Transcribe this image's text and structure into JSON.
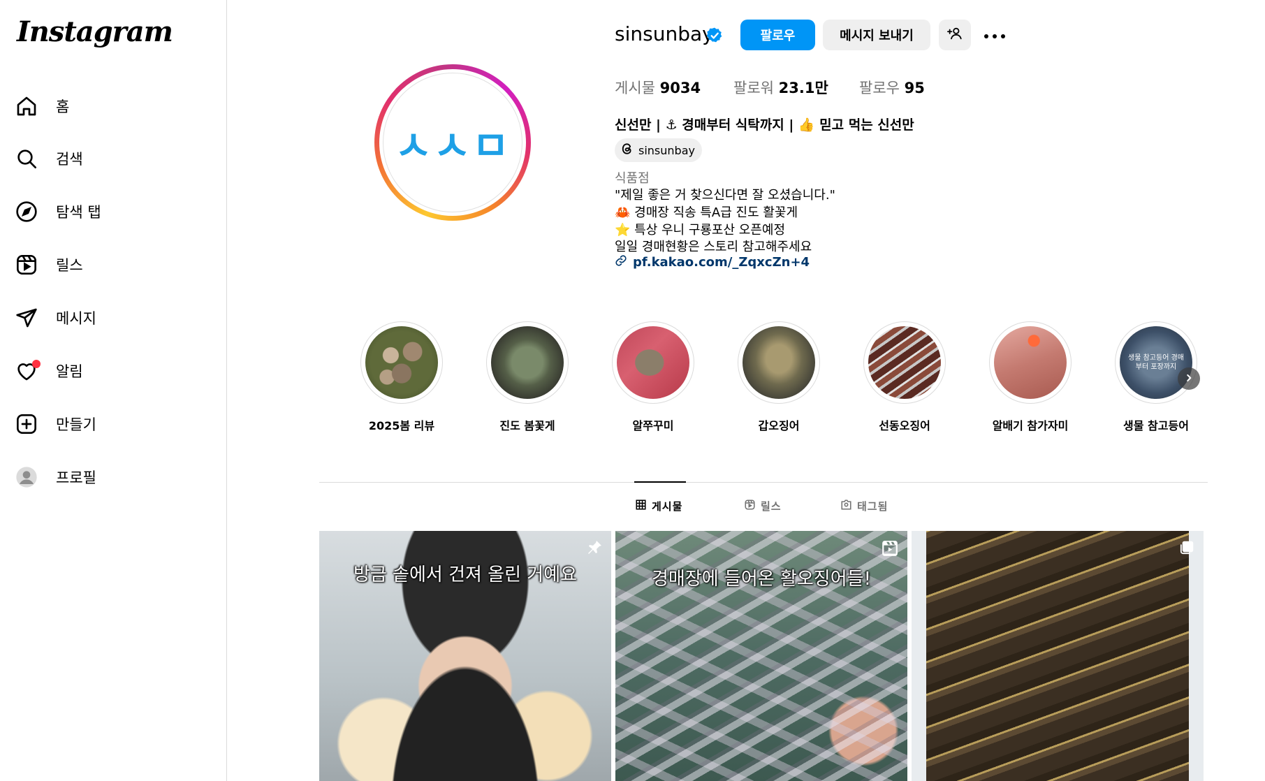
{
  "sidebar": {
    "logo": "Instagram",
    "items": [
      {
        "label": "홈",
        "icon": "home-icon"
      },
      {
        "label": "검색",
        "icon": "search-icon"
      },
      {
        "label": "탐색 탭",
        "icon": "compass-icon"
      },
      {
        "label": "릴스",
        "icon": "reels-icon"
      },
      {
        "label": "메시지",
        "icon": "send-icon"
      },
      {
        "label": "알림",
        "icon": "heart-icon"
      },
      {
        "label": "만들기",
        "icon": "create-icon"
      },
      {
        "label": "프로필",
        "icon": "profile-avatar-icon"
      }
    ]
  },
  "profile": {
    "username": "sinsunbay",
    "verified": true,
    "avatar_text": "ㅅㅅㅁ",
    "follow_label": "팔로우",
    "message_label": "메시지 보내기",
    "stats": {
      "posts_label": "게시물",
      "posts_value": "9034",
      "followers_label": "팔로워",
      "followers_value": "23.1만",
      "following_label": "팔로우",
      "following_value": "95"
    },
    "bio_name": "신선만 | ⚓ 경매부터 식탁까지 | 👍 믿고 먹는 신선만",
    "threads_handle": "sinsunbay",
    "category": "식품점",
    "bio_lines": [
      "\"제일 좋은 거 찾으신다면 잘 오셨습니다.\"",
      "🦀 경매장 직송 특A급 진도 활꽃게",
      "⭐ 특상 우니 구룡포산 오픈예정",
      "일일 경매현황은 스토리 참고해주세요"
    ],
    "link": "pf.kakao.com/_ZqxcZn+4"
  },
  "highlights": [
    {
      "label": "2025봄 리뷰"
    },
    {
      "label": "진도 봄꽃게"
    },
    {
      "label": "알쭈꾸미"
    },
    {
      "label": "갑오징어"
    },
    {
      "label": "선동오징어"
    },
    {
      "label": "알배기 참가자미"
    },
    {
      "label": "생물 참고등어",
      "overlay": "생물 참고등어 경매부터 포장까지"
    }
  ],
  "tabs": [
    {
      "label": "게시물",
      "icon": "grid-icon",
      "active": true
    },
    {
      "label": "릴스",
      "icon": "reels-icon",
      "active": false
    },
    {
      "label": "태그됨",
      "icon": "tagged-icon",
      "active": false
    }
  ],
  "posts": [
    {
      "caption": "방금 솥에서 건져 올린 거예요",
      "corner_icon": "pin-icon"
    },
    {
      "caption": "경매장에 들어온 활오징어들!",
      "corner_icon": "reels-icon"
    },
    {
      "caption": "",
      "corner_icon": "carousel-icon"
    }
  ],
  "colors": {
    "primary": "#0095f6",
    "link": "#00376b",
    "notification": "#ff3040",
    "verified": "#0095f6"
  }
}
